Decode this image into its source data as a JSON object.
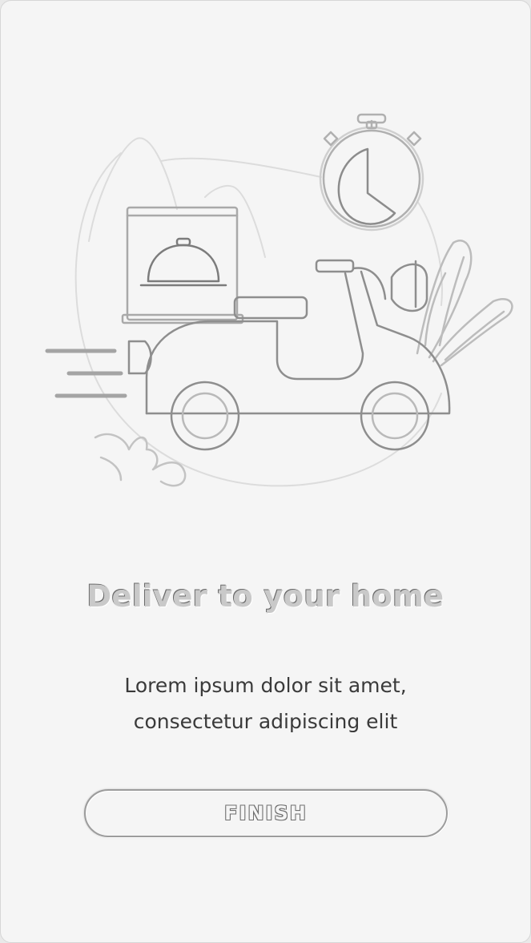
{
  "screen": {
    "title": "Deliver to your home",
    "subtitle_line1": "Lorem ipsum dolor sit amet,",
    "subtitle_line2": "consectetur adipiscing elit",
    "button_label": "FINISH"
  },
  "illustration": {
    "icons": [
      "delivery-scooter-icon",
      "stopwatch-icon",
      "food-cloche-icon",
      "plant-icon",
      "speed-lines-icon"
    ]
  }
}
